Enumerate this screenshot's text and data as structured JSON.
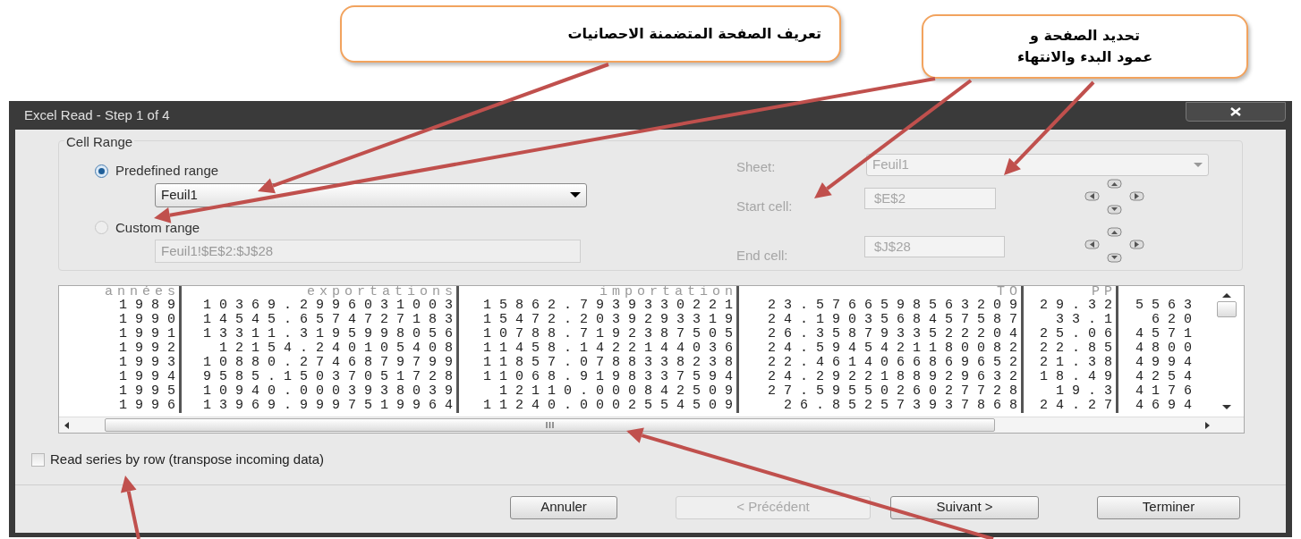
{
  "annotations": [
    {
      "lines": [
        "تحديد الصفحة و",
        "عمود البدء والانتهاء"
      ]
    },
    {
      "lines": [
        "تعريف الصفحة المتضمنة الاحصانيات"
      ]
    }
  ],
  "window": {
    "title": "Excel Read - Step 1 of 4"
  },
  "cell_range": {
    "title": "Cell Range",
    "options": [
      {
        "label": "Predefined range",
        "selected": true,
        "value": "Feuil1"
      },
      {
        "label": "Custom range",
        "selected": false,
        "value": "Feuil1!$E$2:$J$28"
      }
    ],
    "sheet": {
      "label": "Sheet:",
      "value": "Feuil1",
      "disabled": true
    },
    "start_cell": {
      "label": "Start cell:",
      "value": "$E$2",
      "disabled": true
    },
    "end_cell": {
      "label": "End cell:",
      "value": "$J$28",
      "disabled": true
    }
  },
  "table": {
    "columns": [
      "années",
      "exportations",
      "importation",
      "TO",
      "PP",
      ""
    ],
    "rows": [
      [
        "1989",
        "10369.2996031003",
        "15862.7939330221",
        "23.5766598563209",
        "29.32",
        "5563"
      ],
      [
        "1990",
        "14545.6574727183",
        "15472.2039293319",
        "24.1903568457587",
        "33.1",
        "620"
      ],
      [
        "1991",
        "13311.3195998056",
        "10788.7192387505",
        "26.3587933522204",
        "25.06",
        "4571"
      ],
      [
        "1992",
        "12154.240105408",
        "11458.1422144036",
        "24.5945421180082",
        "22.85",
        "4800"
      ],
      [
        "1993",
        "10880.2746879799",
        "11857.0788338238",
        "22.4614066869652",
        "21.38",
        "4994"
      ],
      [
        "1994",
        "9585.15037051728",
        "11068.9198337594",
        "24.2922188929632",
        "18.49",
        "4254"
      ],
      [
        "1995",
        "10940.0003938039",
        "12110.000842509",
        "27.5955026027728",
        "19.3",
        "4176"
      ],
      [
        "1996",
        "13969.9997519964",
        "11240.0002554509",
        "26.852573937868",
        "24.27",
        "4694"
      ]
    ]
  },
  "read_by_row": {
    "label": "Read series by row (transpose incoming data)",
    "checked": false
  },
  "buttons": [
    {
      "label": "Annuler",
      "disabled": false
    },
    {
      "label": "< Précédent",
      "disabled": true
    },
    {
      "label": "Suivant >",
      "disabled": false
    },
    {
      "label": "Terminer",
      "disabled": false
    }
  ]
}
